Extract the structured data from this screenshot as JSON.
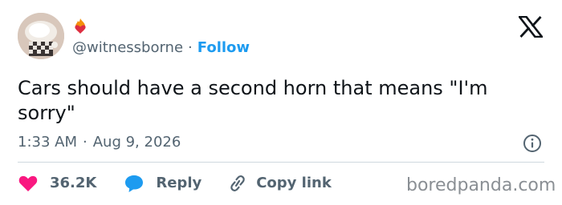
{
  "user": {
    "handle": "@witnessborne",
    "follow_label": "Follow",
    "separator": "·"
  },
  "tweet": {
    "text": "Cars should have a second horn that means \"I'm sorry\"",
    "time": "1:33 AM",
    "date": "Aug 9, 2026",
    "separator": "·"
  },
  "actions": {
    "likes": "36.2K",
    "reply_label": "Reply",
    "copy_label": "Copy link"
  },
  "watermark": "boredpanda.com",
  "icons": {
    "brand": "x-logo-icon",
    "like": "heart-icon",
    "reply": "speech-bubble-icon",
    "copy": "link-icon",
    "info": "info-icon",
    "badge": "flame-heart-icon"
  },
  "colors": {
    "accent": "#1d9bf0",
    "like": "#f91880",
    "reply": "#1d9bf0",
    "muted": "#536471",
    "text": "#0f1419"
  }
}
